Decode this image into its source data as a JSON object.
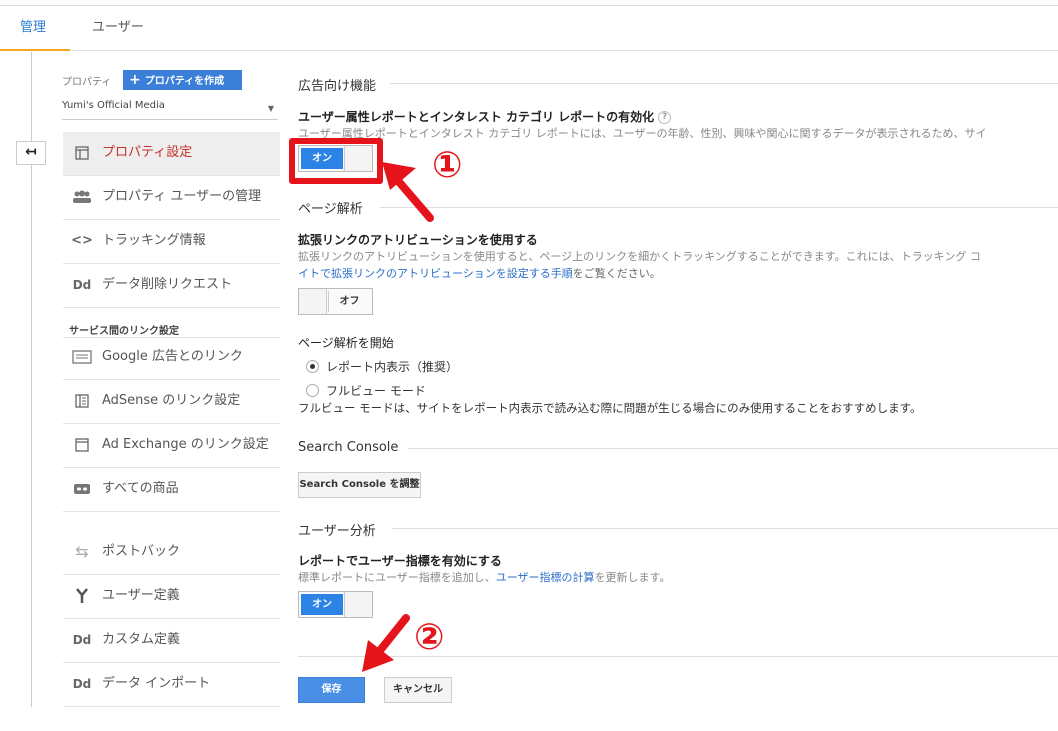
{
  "tabs": [
    {
      "label": "管理"
    },
    {
      "label": "ユーザー"
    }
  ],
  "sidebar": {
    "property_label": "プロパティ",
    "create_button": "プロパティを作成",
    "property_name": "Yumi's Official Media",
    "items": [
      {
        "label": "プロパティ設定",
        "icon": "property-icon"
      },
      {
        "label": "プロパティ ユーザーの管理",
        "icon": "users-icon"
      },
      {
        "label": "トラッキング情報",
        "icon": "code-icon"
      },
      {
        "label": "データ削除リクエスト",
        "icon": "dd-icon"
      }
    ],
    "section_title": "サービス間のリンク設定",
    "link_items": [
      {
        "label": "Google 広告とのリンク",
        "icon": "ads-icon"
      },
      {
        "label": "AdSense のリンク設定",
        "icon": "adsense-icon"
      },
      {
        "label": "Ad Exchange のリンク設定",
        "icon": "adexchange-icon"
      },
      {
        "label": "すべての商品",
        "icon": "link-icon"
      }
    ],
    "other_items": [
      {
        "label": "ポストバック",
        "icon": "postback-icon"
      },
      {
        "label": "ユーザー定義",
        "icon": "fork-icon"
      },
      {
        "label": "カスタム定義",
        "icon": "dd-icon"
      },
      {
        "label": "データ インポート",
        "icon": "dd-icon"
      }
    ]
  },
  "main": {
    "ad_section": "広告向け機能",
    "ad_title": "ユーザー属性レポートとインタレスト カテゴリ レポートの有効化",
    "ad_help": "?",
    "ad_desc": "ユーザー属性レポートとインタレスト カテゴリ レポートには、ユーザーの年齢、性別、興味や関心に関するデータが表示されるため、サイ",
    "ad_toggle": "オン",
    "page_section": "ページ解析",
    "enhanced_title": "拡張リンクのアトリビューションを使用する",
    "enhanced_desc1": "拡張リンクのアトリビューションを使用すると、ページ上のリンクを細かくトラッキングすることができます。これには、トラッキング コ",
    "enhanced_desc2_link": "イトで拡張リンクのアトリビューションを設定する手順",
    "enhanced_desc2_rest": "をご覧ください。",
    "enhanced_toggle": "オフ",
    "start_title": "ページ解析を開始",
    "radio_inpage": "レポート内表示（推奨）",
    "radio_full": "フルビュー モード",
    "full_desc": "フルビュー モードは、サイトをレポート内表示で読み込む際に問題が生じる場合にのみ使用することをおすすめします。",
    "sc_section": "Search Console",
    "sc_button": "Search Console を調整",
    "user_section": "ユーザー分析",
    "user_title": "レポートでユーザー指標を有効にする",
    "user_desc": "標準レポートにユーザー指標を追加し、",
    "user_desc_link": "ユーザー指標の計算",
    "user_desc_rest": "を更新します。",
    "user_toggle": "オン",
    "save_button": "保存",
    "cancel_button": "キャンセル"
  },
  "annotations": {
    "one": "①",
    "two": "②"
  },
  "colors": {
    "accent": "#2b83e6",
    "active_text": "#c5322a",
    "annotation": "#e4141a",
    "tab_underline": "#f5a623"
  }
}
